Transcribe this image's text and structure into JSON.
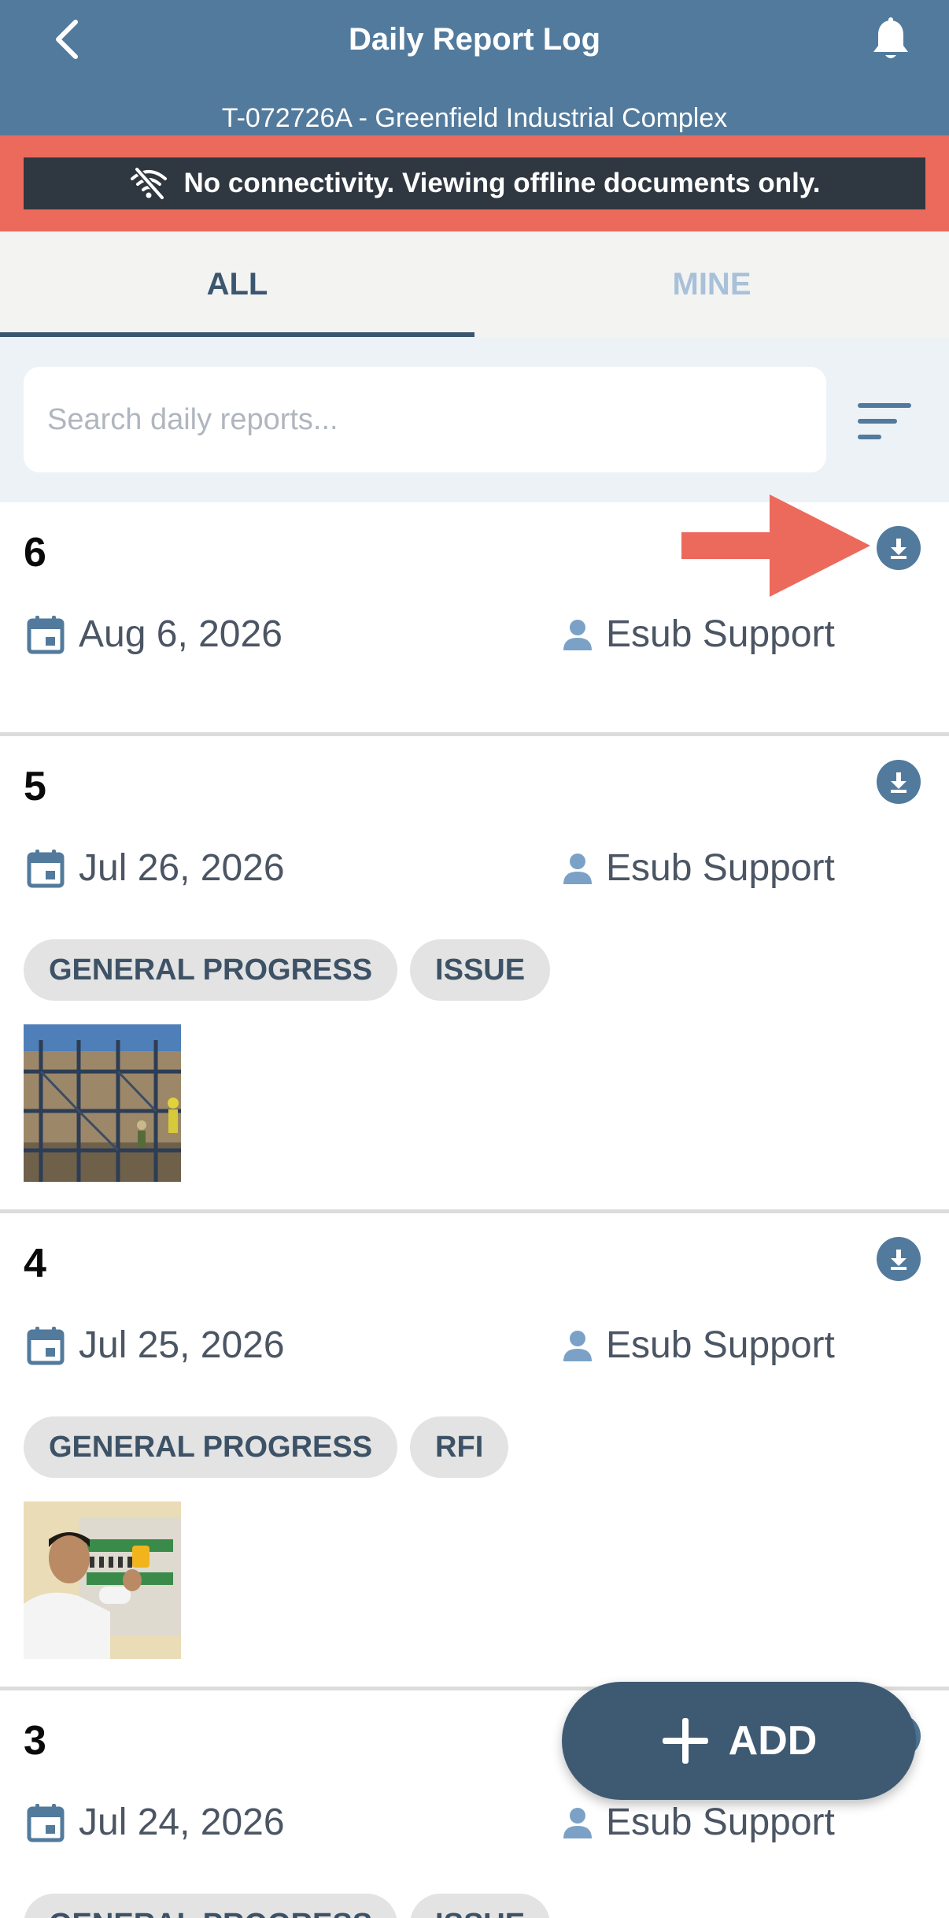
{
  "header": {
    "title": "Daily Report Log",
    "subtitle": "T-072726A - Greenfield Industrial Complex"
  },
  "offline_banner": {
    "text": "No connectivity. Viewing offline documents only."
  },
  "tabs": [
    {
      "label": "ALL",
      "active": true
    },
    {
      "label": "MINE",
      "active": false
    }
  ],
  "search": {
    "placeholder": "Search daily reports...",
    "value": ""
  },
  "reports": [
    {
      "number": "6",
      "date": "Aug 6, 2026",
      "author": "Esub Support",
      "tags": []
    },
    {
      "number": "5",
      "date": "Jul 26, 2026",
      "author": "Esub Support",
      "tags": [
        "GENERAL PROGRESS",
        "ISSUE"
      ]
    },
    {
      "number": "4",
      "date": "Jul 25, 2026",
      "author": "Esub Support",
      "tags": [
        "GENERAL PROGRESS",
        "RFI"
      ]
    },
    {
      "number": "3",
      "date": "Jul 24, 2026",
      "author": "Esub Support",
      "tags": [
        "GENERAL PROGRESS",
        "ISSUE"
      ]
    }
  ],
  "fab": {
    "label": "ADD"
  },
  "colors": {
    "header": "#527a9c",
    "banner_border": "#ec6a5c",
    "banner_bg": "#2f3740",
    "accent": "#3b5770",
    "annotation_arrow": "#ec6a5c"
  },
  "icons": [
    "back-arrow-icon",
    "bell-icon",
    "wifi-off-icon",
    "sort-icon",
    "download-icon",
    "calendar-icon",
    "person-icon",
    "plus-icon"
  ]
}
